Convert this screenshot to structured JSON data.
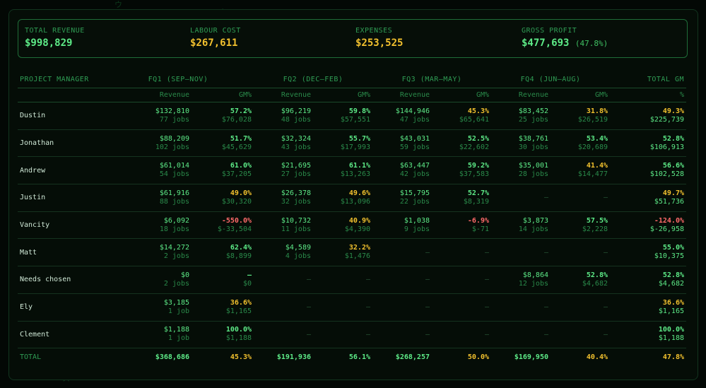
{
  "colors": {
    "good": "#5dea87",
    "warn": "#f2c12e",
    "bad": "#ff6a6a",
    "muted": "#2a8a4a"
  },
  "summary": [
    {
      "label": "TOTAL REVENUE",
      "value": "$998,829",
      "pct": "",
      "color": "green"
    },
    {
      "label": "LABOUR COST",
      "value": "$267,611",
      "pct": "",
      "color": "yellow"
    },
    {
      "label": "EXPENSES",
      "value": "$253,525",
      "pct": "",
      "color": "yellow"
    },
    {
      "label": "GROSS PROFIT",
      "value": "$477,693",
      "pct": "(47.8%)",
      "color": "green"
    }
  ],
  "table": {
    "head": {
      "pm": "PROJECT MANAGER",
      "quarters": [
        "FQ1 (SEP–NOV)",
        "FQ2 (DEC–FEB)",
        "FQ3 (MAR–MAY)",
        "FQ4 (JUN–AUG)"
      ],
      "total": "TOTAL GM",
      "sub_revenue": "Revenue",
      "sub_gm": "GM%",
      "sub_pct": "%"
    },
    "rows": [
      {
        "name": "Dustin",
        "cells": [
          {
            "rev": "$132,810",
            "jobs": "77 jobs",
            "gm": "57.2%",
            "gp": "$76,028",
            "c": "green"
          },
          {
            "rev": "$96,219",
            "jobs": "48 jobs",
            "gm": "59.8%",
            "gp": "$57,551",
            "c": "green"
          },
          {
            "rev": "$144,946",
            "jobs": "47 jobs",
            "gm": "45.3%",
            "gp": "$65,641",
            "c": "yellow"
          },
          {
            "rev": "$83,452",
            "jobs": "25 jobs",
            "gm": "31.8%",
            "gp": "$26,519",
            "c": "yellow"
          }
        ],
        "total": {
          "gm": "49.3%",
          "gp": "$225,739",
          "c": "yellow"
        }
      },
      {
        "name": "Jonathan",
        "cells": [
          {
            "rev": "$88,209",
            "jobs": "102 jobs",
            "gm": "51.7%",
            "gp": "$45,629",
            "c": "green"
          },
          {
            "rev": "$32,324",
            "jobs": "43 jobs",
            "gm": "55.7%",
            "gp": "$17,993",
            "c": "green"
          },
          {
            "rev": "$43,031",
            "jobs": "59 jobs",
            "gm": "52.5%",
            "gp": "$22,602",
            "c": "green"
          },
          {
            "rev": "$38,761",
            "jobs": "30 jobs",
            "gm": "53.4%",
            "gp": "$20,689",
            "c": "green"
          }
        ],
        "total": {
          "gm": "52.8%",
          "gp": "$106,913",
          "c": "green"
        }
      },
      {
        "name": "Andrew",
        "cells": [
          {
            "rev": "$61,014",
            "jobs": "54 jobs",
            "gm": "61.0%",
            "gp": "$37,205",
            "c": "green"
          },
          {
            "rev": "$21,695",
            "jobs": "27 jobs",
            "gm": "61.1%",
            "gp": "$13,263",
            "c": "green"
          },
          {
            "rev": "$63,447",
            "jobs": "42 jobs",
            "gm": "59.2%",
            "gp": "$37,583",
            "c": "green"
          },
          {
            "rev": "$35,001",
            "jobs": "28 jobs",
            "gm": "41.4%",
            "gp": "$14,477",
            "c": "yellow"
          }
        ],
        "total": {
          "gm": "56.6%",
          "gp": "$102,528",
          "c": "green"
        }
      },
      {
        "name": "Justin",
        "cells": [
          {
            "rev": "$61,916",
            "jobs": "88 jobs",
            "gm": "49.0%",
            "gp": "$30,320",
            "c": "yellow"
          },
          {
            "rev": "$26,378",
            "jobs": "32 jobs",
            "gm": "49.6%",
            "gp": "$13,096",
            "c": "yellow"
          },
          {
            "rev": "$15,795",
            "jobs": "22 jobs",
            "gm": "52.7%",
            "gp": "$8,319",
            "c": "green"
          },
          null
        ],
        "total": {
          "gm": "49.7%",
          "gp": "$51,736",
          "c": "yellow"
        }
      },
      {
        "name": "Vancity",
        "cells": [
          {
            "rev": "$6,092",
            "jobs": "18 jobs",
            "gm": "-550.0%",
            "gp": "$-33,504",
            "c": "red"
          },
          {
            "rev": "$10,732",
            "jobs": "11 jobs",
            "gm": "40.9%",
            "gp": "$4,390",
            "c": "yellow"
          },
          {
            "rev": "$1,038",
            "jobs": "9 jobs",
            "gm": "-6.9%",
            "gp": "$-71",
            "c": "red"
          },
          {
            "rev": "$3,873",
            "jobs": "14 jobs",
            "gm": "57.5%",
            "gp": "$2,228",
            "c": "green"
          }
        ],
        "total": {
          "gm": "-124.0%",
          "gp": "$-26,958",
          "c": "red"
        }
      },
      {
        "name": "Matt",
        "cells": [
          {
            "rev": "$14,272",
            "jobs": "2 jobs",
            "gm": "62.4%",
            "gp": "$8,899",
            "c": "green"
          },
          {
            "rev": "$4,589",
            "jobs": "4 jobs",
            "gm": "32.2%",
            "gp": "$1,476",
            "c": "yellow"
          },
          null,
          null
        ],
        "total": {
          "gm": "55.0%",
          "gp": "$10,375",
          "c": "green"
        }
      },
      {
        "name": "Needs chosen",
        "cells": [
          {
            "rev": "$0",
            "jobs": "2 jobs",
            "gm": "—",
            "gp": "$0",
            "c": "green"
          },
          null,
          null,
          {
            "rev": "$8,864",
            "jobs": "12 jobs",
            "gm": "52.8%",
            "gp": "$4,682",
            "c": "green"
          }
        ],
        "total": {
          "gm": "52.8%",
          "gp": "$4,682",
          "c": "green"
        }
      },
      {
        "name": "Ely",
        "cells": [
          {
            "rev": "$3,185",
            "jobs": "1 job",
            "gm": "36.6%",
            "gp": "$1,165",
            "c": "yellow"
          },
          null,
          null,
          null
        ],
        "total": {
          "gm": "36.6%",
          "gp": "$1,165",
          "c": "yellow"
        }
      },
      {
        "name": "Clement",
        "cells": [
          {
            "rev": "$1,188",
            "jobs": "1 job",
            "gm": "100.0%",
            "gp": "$1,188",
            "c": "green"
          },
          null,
          null,
          null
        ],
        "total": {
          "gm": "100.0%",
          "gp": "$1,188",
          "c": "green"
        }
      }
    ],
    "dash": "—",
    "total_row": {
      "label": "TOTAL",
      "cells": [
        {
          "rev": "$368,686",
          "gm": "45.3%",
          "c": "yellow"
        },
        {
          "rev": "$191,936",
          "gm": "56.1%",
          "c": "green"
        },
        {
          "rev": "$268,257",
          "gm": "50.0%",
          "c": "yellow"
        },
        {
          "rev": "$169,950",
          "gm": "40.4%",
          "c": "yellow"
        }
      ],
      "total": {
        "gm": "47.8%",
        "c": "yellow"
      }
    }
  }
}
